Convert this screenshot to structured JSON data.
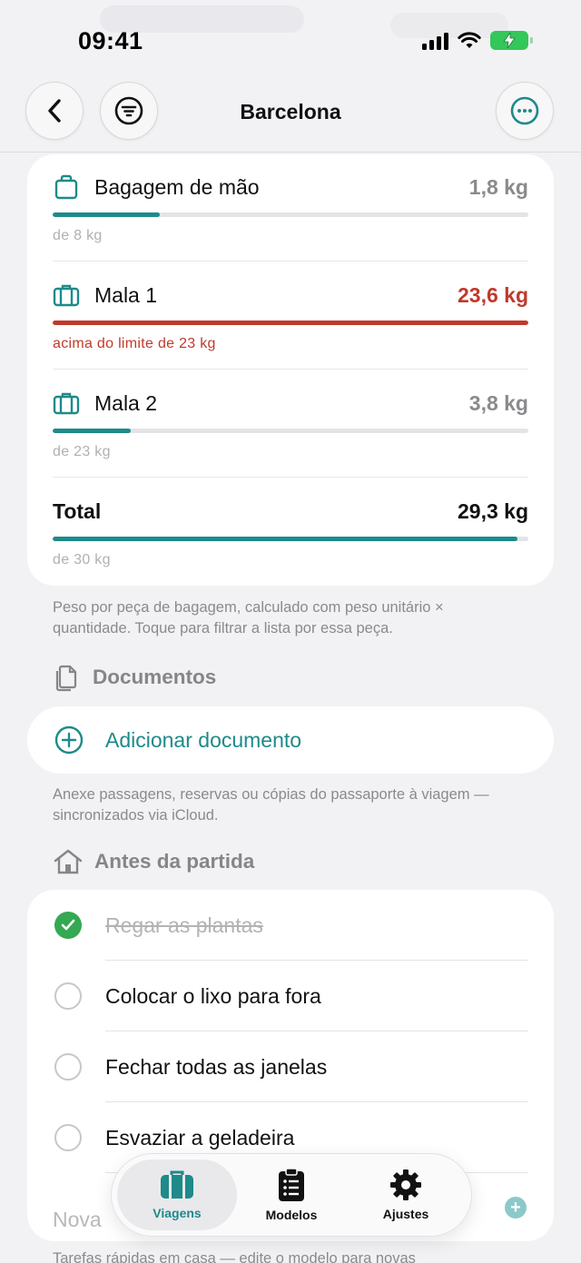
{
  "status_bar": {
    "time": "09:41"
  },
  "nav": {
    "title": "Barcelona"
  },
  "luggage": {
    "items": [
      {
        "name": "Bagagem de mão",
        "weight": "1,8 kg",
        "subtitle": "de 8 kg",
        "fill_fraction": 0.225,
        "over_limit": false,
        "icon": "handbag-icon"
      },
      {
        "name": "Mala 1",
        "weight": "23,6 kg",
        "subtitle": "acima do limite de 23 kg",
        "fill_fraction": 1.0,
        "over_limit": true,
        "icon": "suitcase-icon"
      },
      {
        "name": "Mala 2",
        "weight": "3,8 kg",
        "subtitle": "de 23 kg",
        "fill_fraction": 0.165,
        "over_limit": false,
        "icon": "suitcase-icon"
      }
    ],
    "total": {
      "name": "Total",
      "weight": "29,3 kg",
      "subtitle": "de 30 kg",
      "fill_fraction": 0.977
    },
    "footnote": "Peso por peça de bagagem, calculado com peso unitário × quantidade. Toque para filtrar a lista por essa peça."
  },
  "documents": {
    "section_title": "Documentos",
    "add_label": "Adicionar documento",
    "footnote": "Anexe passagens, reservas ou cópias do passaporte à viagem — sincronizados via iCloud."
  },
  "before_departure": {
    "section_title": "Antes da partida",
    "tasks": [
      {
        "label": "Regar as plantas",
        "done": true
      },
      {
        "label": "Colocar o lixo para fora",
        "done": false
      },
      {
        "label": "Fechar todas as janelas",
        "done": false
      },
      {
        "label": "Esvaziar a geladeira",
        "done": false
      }
    ],
    "new_task_placeholder": "Nova",
    "footnote": "Tarefas rápidas em casa — edite o modelo para novas"
  },
  "tabbar": {
    "tabs": [
      {
        "label": "Viagens",
        "icon": "suitcase-icon",
        "active": true
      },
      {
        "label": "Modelos",
        "icon": "checklist-icon",
        "active": false
      },
      {
        "label": "Ajustes",
        "icon": "gear-icon",
        "active": false
      }
    ]
  },
  "colors": {
    "accent": "#1e8a8a",
    "over_limit": "#c0392b",
    "done": "#34a853"
  }
}
